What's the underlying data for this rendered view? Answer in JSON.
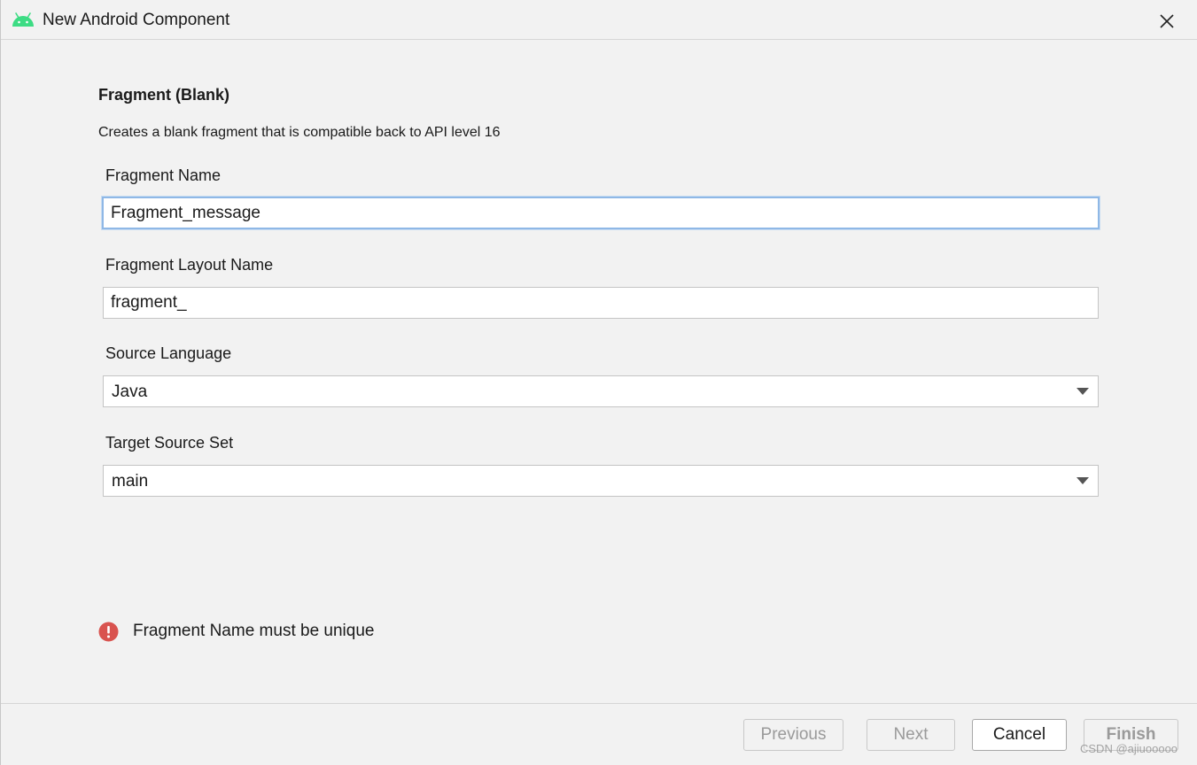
{
  "window": {
    "title": "New Android Component"
  },
  "template": {
    "heading": "Fragment (Blank)",
    "description": "Creates a blank fragment that is compatible back to API level 16"
  },
  "fields": {
    "fragment_name": {
      "label": "Fragment Name",
      "value": "Fragment_message"
    },
    "fragment_layout_name": {
      "label": "Fragment Layout Name",
      "value": "fragment_"
    },
    "source_language": {
      "label": "Source Language",
      "selected": "Java"
    },
    "target_source_set": {
      "label": "Target Source Set",
      "selected": "main"
    }
  },
  "validation": {
    "message": "Fragment Name must be unique",
    "icon": "error-icon",
    "color": "#d9534f"
  },
  "buttons": {
    "previous": "Previous",
    "next": "Next",
    "cancel": "Cancel",
    "finish": "Finish"
  },
  "watermark": "CSDN @ajiuooooo",
  "colors": {
    "android_green": "#3ddc84",
    "focus_border": "#8fb8e6",
    "error_red": "#d9534f"
  }
}
